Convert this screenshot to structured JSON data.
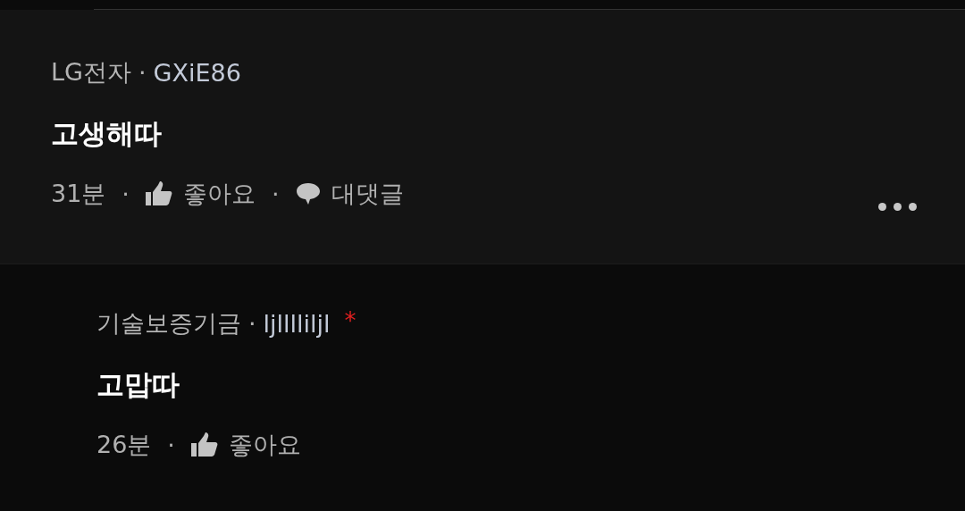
{
  "comments": [
    {
      "org": "LG전자",
      "separator": "·",
      "user": "GXiE86",
      "body": "고생해따",
      "time": "31분",
      "meta_separators": [
        "·",
        "·"
      ],
      "like": "좋아요",
      "reply": "대댓글",
      "replies": [
        {
          "org": "기술보증기금",
          "separator": "·",
          "user": "ljlllliljl",
          "badge": "*",
          "body": "고맙따",
          "time": "26분",
          "meta_separators": [
            "·"
          ],
          "like": "좋아요"
        }
      ]
    }
  ]
}
